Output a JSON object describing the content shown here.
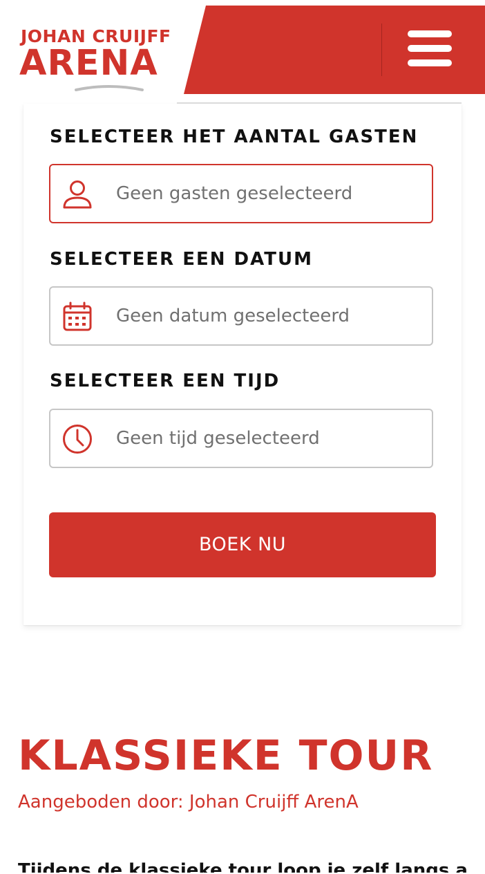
{
  "colors": {
    "brand_red": "#d0342c",
    "label_text": "#111111",
    "placeholder": "#707070"
  },
  "header": {
    "logo_line1": "JOHAN CRUIJFF",
    "logo_line2": "ARENA",
    "menu_icon": "hamburger-menu-icon"
  },
  "booking": {
    "guests": {
      "label": "SELECTEER HET AANTAL GASTEN",
      "placeholder": "Geen gasten geselecteerd",
      "icon": "person-icon"
    },
    "date": {
      "label": "SELECTEER EEN DATUM",
      "placeholder": "Geen datum geselecteerd",
      "icon": "calendar-icon"
    },
    "time": {
      "label": "SELECTEER EEN TIJD",
      "placeholder": "Geen tijd geselecteerd",
      "icon": "clock-icon"
    },
    "book_button": "BOEK NU"
  },
  "tour": {
    "title": "KLASSIEKE TOUR",
    "offered_by": "Aangeboden door: Johan Cruijff ArenA",
    "body_partial": "Tijdens de klassieke tour loop je zelf langs alle"
  }
}
